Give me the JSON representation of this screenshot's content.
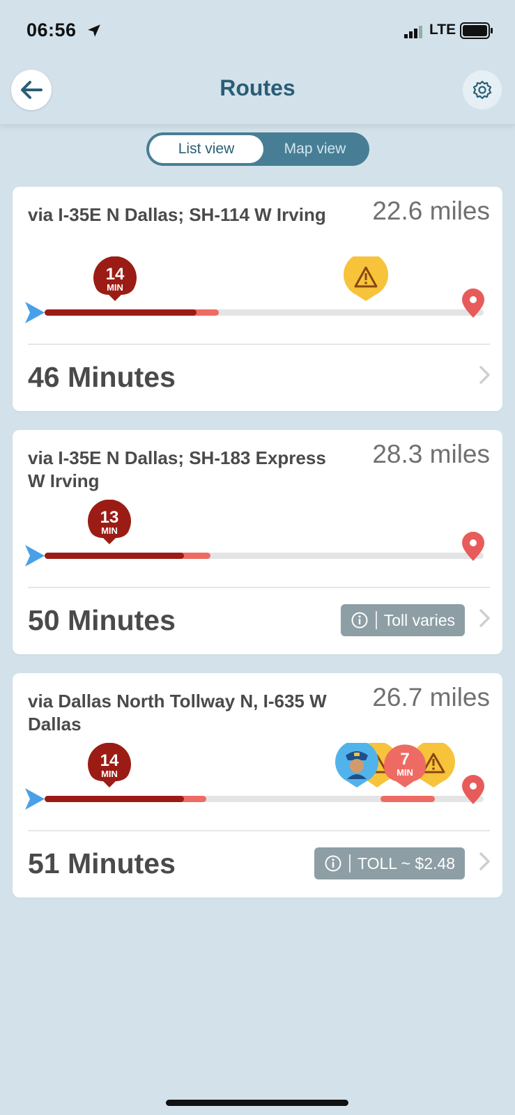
{
  "status_bar": {
    "time": "06:56",
    "network": "LTE"
  },
  "header": {
    "title": "Routes"
  },
  "view_toggle": {
    "list_label": "List view",
    "map_label": "Map view",
    "selected": "List view"
  },
  "routes": [
    {
      "name": "via I-35E N Dallas; SH-114 W Irving",
      "distance": "22.6 miles",
      "delay_number": "14",
      "delay_unit": "MIN",
      "duration": "46 Minutes",
      "toll": ""
    },
    {
      "name": "via I-35E N Dallas; SH-183 Express W Irving",
      "distance": "28.3 miles",
      "delay_number": "13",
      "delay_unit": "MIN",
      "duration": "50 Minutes",
      "toll": "Toll varies"
    },
    {
      "name": "via Dallas North Tollway N, I-635 W Dallas",
      "distance": "26.7 miles",
      "delay_number": "14",
      "delay_unit": "MIN",
      "second_delay_number": "7",
      "second_delay_unit": "MIN",
      "duration": "51 Minutes",
      "toll": "TOLL ~ $2.48"
    }
  ],
  "colors": {
    "heavy_traffic": "#9b1c15",
    "moderate_traffic": "#ee6b63",
    "hazard": "#f6c33a",
    "police": "#52b3ea",
    "start": "#4aa0e8",
    "destination": "#e85b5b"
  }
}
